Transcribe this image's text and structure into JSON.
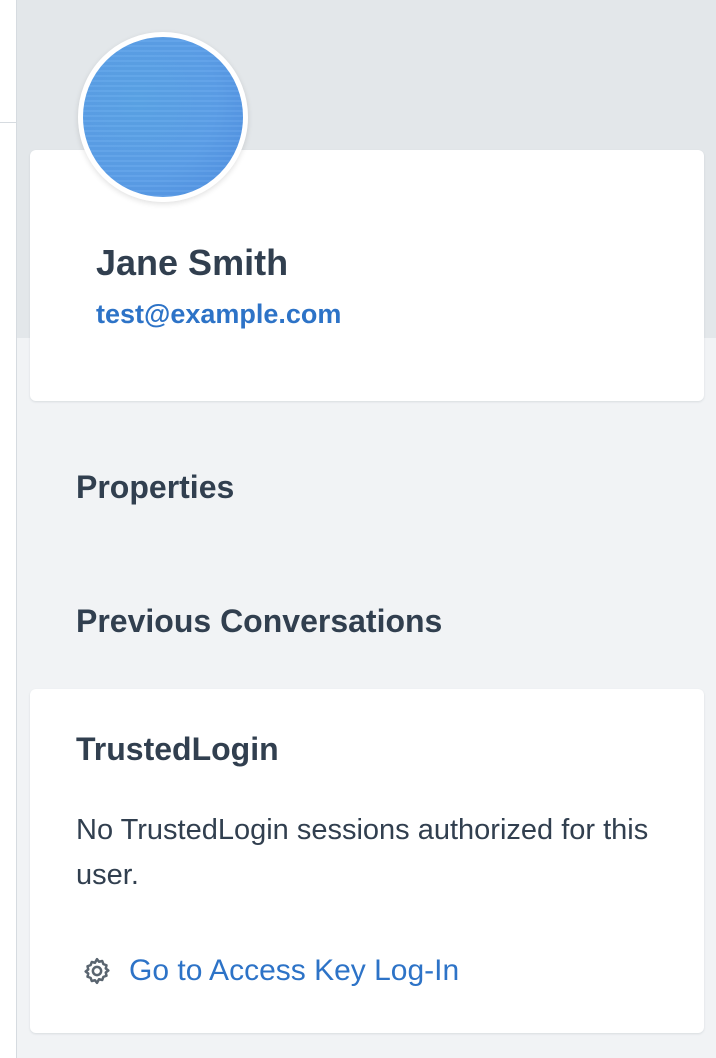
{
  "profile": {
    "name": "Jane Smith",
    "email": "test@example.com"
  },
  "sections": {
    "properties": "Properties",
    "previous_conversations": "Previous Conversations"
  },
  "trusted_login": {
    "title": "TrustedLogin",
    "message": "No TrustedLogin sessions authorized for this user.",
    "link_label": "Go to Access Key Log-In",
    "link_icon": "gear-icon"
  },
  "colors": {
    "link": "#2d73c7",
    "text": "#313f4f",
    "sidebar_bg": "#f1f3f5",
    "header_band": "#e3e7ea",
    "avatar": "#5b9ee8"
  }
}
